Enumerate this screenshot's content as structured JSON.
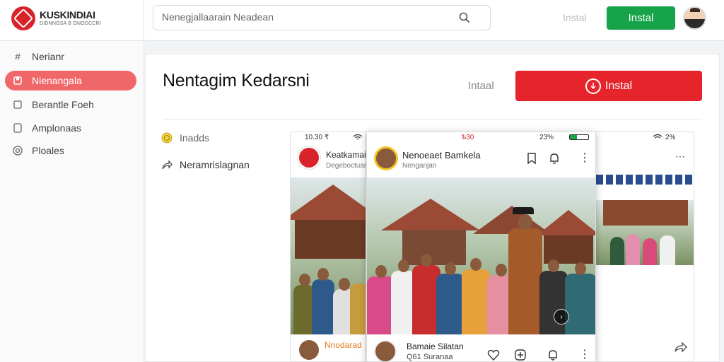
{
  "brand": {
    "name": "KUSKINDIAI",
    "subtitle": "DIDNNGSA B ONODCCRI"
  },
  "search": {
    "placeholder": "Nenegjallaarain Neadean"
  },
  "topbar": {
    "link_label": "Instal",
    "button_label": "Instal"
  },
  "sidebar": {
    "items": [
      {
        "label": "Nerianr",
        "icon": "hashtag-icon",
        "active": false
      },
      {
        "label": "Nienangala",
        "icon": "bookmark-icon",
        "active": true
      },
      {
        "label": "Berantle Foeh",
        "icon": "square-icon",
        "active": false
      },
      {
        "label": "Amplonaas",
        "icon": "square-icon",
        "active": false
      },
      {
        "label": "Ploales",
        "icon": "target-icon",
        "active": false
      }
    ]
  },
  "main": {
    "title": "Nentagim Kedarsni",
    "link_label": "Intaal",
    "button_label": "Instal",
    "sub_items": [
      {
        "label": "Inadds",
        "icon": "coin-icon"
      },
      {
        "label": "Neramrislagnan",
        "icon": "share-icon"
      }
    ]
  },
  "preview_left": {
    "status_time": "10.30 ₹",
    "post_name": "Keatkamai",
    "post_sub": "Degeboctuan",
    "footer_name": "Nnodarad"
  },
  "preview_center": {
    "status_left": "ѣ30",
    "status_right": "23%",
    "post_name": "Nenoeaet Bamkela",
    "post_sub": "Nenganjan",
    "footer_name": "Bamaie Silatan",
    "footer_sub": "Q61 Suranaa"
  },
  "preview_right": {
    "status_right": "2%"
  },
  "colors": {
    "accent_red": "#e5242b",
    "sidebar_active": "#f0676a",
    "install_green": "#16a34a"
  }
}
